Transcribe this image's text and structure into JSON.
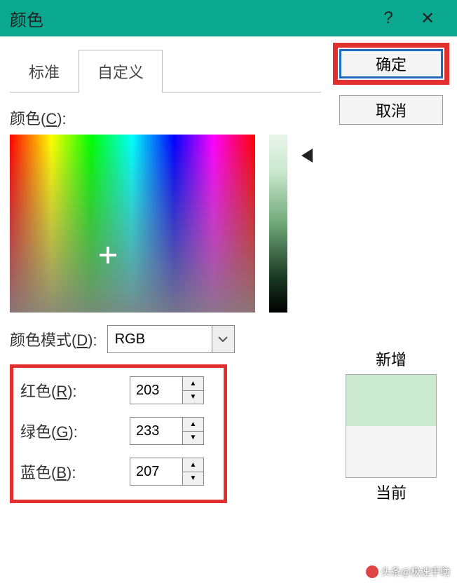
{
  "titlebar": {
    "title": "颜色",
    "help": "?",
    "close": "✕"
  },
  "buttons": {
    "ok": "确定",
    "cancel": "取消"
  },
  "tabs": {
    "standard": "标准",
    "custom": "自定义"
  },
  "labels": {
    "colors": "颜色",
    "colors_key": "C",
    "mode": "颜色模式",
    "mode_key": "D",
    "mode_value": "RGB",
    "red": "红色",
    "red_key": "R",
    "green": "绿色",
    "green_key": "G",
    "blue": "蓝色",
    "blue_key": "B",
    "new": "新增",
    "current": "当前"
  },
  "rgb": {
    "r": "203",
    "g": "233",
    "b": "207"
  },
  "watermark": "头条@极速手助"
}
